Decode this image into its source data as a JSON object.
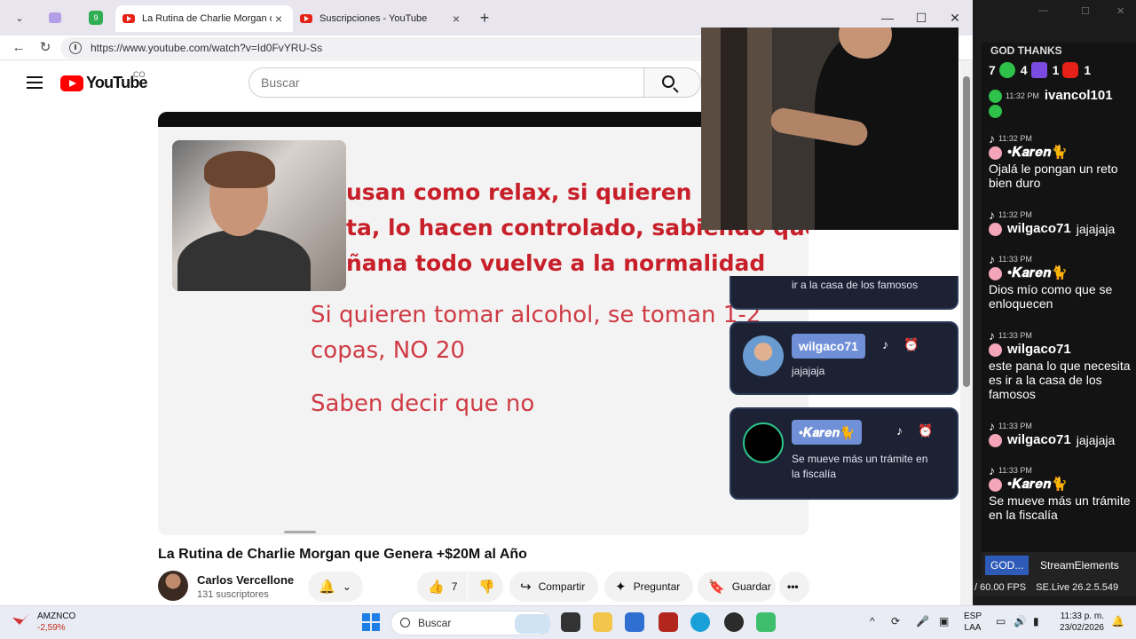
{
  "browser": {
    "tabs": [
      {
        "label": "La Rutina de Charlie Morgan que G",
        "active": true
      },
      {
        "label": "Suscripciones - YouTube",
        "active": false
      }
    ],
    "url": "https://www.youtube.com/watch?v=Id0FvYRU-Ss",
    "new_tab_symbol": "+",
    "badge_count": "9"
  },
  "youtube": {
    "logo_text": "YouTube",
    "country_code": "CO",
    "search_placeholder": "Buscar",
    "video_title": "La Rutina de Charlie Morgan que Genera +$20M al Año",
    "channel_name": "Carlos Vercellone",
    "channel_subs": "131 suscriptores",
    "likes": "7",
    "actions": {
      "share": "Compartir",
      "ask": "Preguntar",
      "save": "Guardar"
    },
    "slide": {
      "red_lines": [
        "usan como relax, si quieren re",
        "ta, lo hacen controlado, sabiendo que",
        "ñana todo vuelve a la normalidad"
      ],
      "line_a": "Si quieren tomar alcohol, se toman 1-2",
      "line_b": "copas, NO 20",
      "line_c": "Saben decir que no"
    }
  },
  "overlay_cards": [
    {
      "msg": "ir a la casa de los famosos"
    },
    {
      "name": "wilgaco71",
      "msg": "jajajaja"
    },
    {
      "name": "•𝑲𝒂𝒓𝒆𝒏🐈",
      "msg_line1": "Se mueve más un trámite en",
      "msg_line2": "la fiscalía"
    }
  ],
  "chat": {
    "header": "GOD THANKS",
    "counts": [
      "7",
      "4",
      "1",
      "1"
    ],
    "messages": [
      {
        "time": "11:32 PM",
        "user": "ivancol101",
        "text": ""
      },
      {
        "time": "11:32 PM",
        "user": "•𝑲𝒂𝒓𝒆𝒏🐈",
        "text": "Ojalá le pongan un reto bien duro"
      },
      {
        "time": "11:32 PM",
        "user": "wilgaco71",
        "text": "jajajaja"
      },
      {
        "time": "11:33 PM",
        "user": "•𝑲𝒂𝒓𝒆𝒏🐈",
        "text": "Dios mío como que se enloquecen"
      },
      {
        "time": "11:33 PM",
        "user": "wilgaco71",
        "text": "este pana lo que necesita es ir a la casa de los famosos"
      },
      {
        "time": "11:33 PM",
        "user": "wilgaco71",
        "text": "jajajaja"
      },
      {
        "time": "11:33 PM",
        "user": "•𝑲𝒂𝒓𝒆𝒏🐈",
        "text": "Se mueve más un trámite en la fiscalía"
      }
    ],
    "tab1": "GOD...",
    "tab2": "StreamElements ...",
    "status_fps": "/ 60.00 FPS",
    "status_live": "SE.Live 26.2.5.549"
  },
  "taskbar": {
    "stock_name": "AMZNCO",
    "stock_change": "-2,59%",
    "search_label": "Buscar",
    "lang_line1": "ESP",
    "lang_line2": "LAA",
    "time": "11:33 p. m.",
    "date": "23/02/2026"
  }
}
